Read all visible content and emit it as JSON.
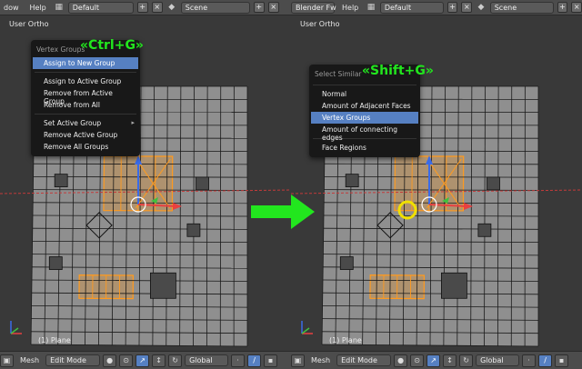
{
  "left": {
    "topbar": {
      "window_menu": "dow",
      "help_menu": "Help",
      "layout_value": "Default",
      "scene_value": "Scene"
    },
    "viewport_label": "User Ortho",
    "object_label": "(1) Plane",
    "shortcut_label": "«Ctrl+G»",
    "menu": {
      "title": "Vertex Groups",
      "items": [
        {
          "label": "Assign to New Group",
          "highlighted": true
        },
        {
          "label": "Assign to Active Group"
        },
        {
          "label": "Remove from Active Group"
        },
        {
          "label": "Remove from All"
        },
        {
          "label": "Set Active Group",
          "has_submenu": true
        },
        {
          "label": "Remove Active Group"
        },
        {
          "label": "Remove All Groups"
        }
      ]
    },
    "bottombar": {
      "mesh_menu": "Mesh",
      "mode_value": "Edit Mode",
      "orientation_value": "Global"
    }
  },
  "right": {
    "topbar": {
      "engine_value": "Blender Fw",
      "help_menu": "Help",
      "layout_value": "Default",
      "scene_value": "Scene"
    },
    "viewport_label": "User Ortho",
    "object_label": "(1) Plane",
    "shortcut_label": "«Shift+G»",
    "menu": {
      "title": "Select Similar",
      "items": [
        {
          "label": "Normal"
        },
        {
          "label": "Amount of Adjacent Faces"
        },
        {
          "label": "Vertex Groups",
          "highlighted": true
        },
        {
          "label": "Amount of connecting edges"
        },
        {
          "label": "Face Regions"
        }
      ]
    },
    "bottombar": {
      "mesh_menu": "Mesh",
      "mode_value": "Edit Mode",
      "orientation_value": "Global"
    }
  },
  "colors": {
    "mesh_face": "#8f8f8f",
    "mesh_edge": "#1a1a1a",
    "selection": "#ff9a1e",
    "shortcut": "#22e61e",
    "transition_arrow": "#22e61e",
    "highlight": "#5680c2",
    "cursor_ring": "#f0e000"
  },
  "icons": [
    "view-icon",
    "shading-icon",
    "pivot-icon",
    "manipulator-icon",
    "snap-icon",
    "layer-icon"
  ]
}
